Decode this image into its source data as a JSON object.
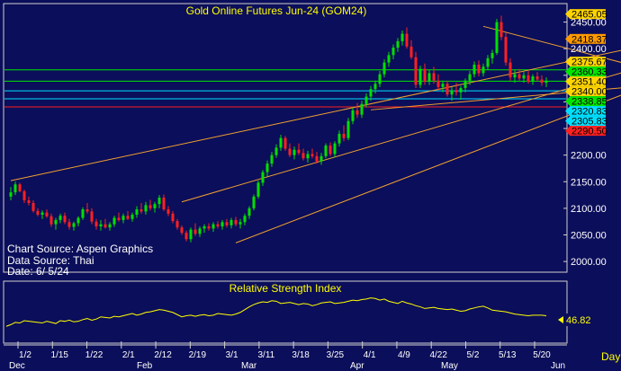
{
  "chart_data": [
    {
      "type": "candlestick",
      "title": "Gold Online Futures Jun-24 (GOM24)",
      "ylim": [
        1985,
        2478
      ],
      "y_ticks": [
        2000.0,
        2050.0,
        2100.0,
        2150.0,
        2200.0,
        2250.0,
        2300.0,
        2350.0,
        2400.0,
        2450.0
      ],
      "price_tags": [
        {
          "value": 2465.05,
          "label": "2465.05",
          "color": "#ffd400"
        },
        {
          "value": 2418.37,
          "label": "2418.37",
          "color": "#ff9a00"
        },
        {
          "value": 2375.67,
          "label": "2375.67",
          "color": "#ffd400"
        },
        {
          "value": 2360.33,
          "label": "2360.33",
          "color": "#00e600"
        },
        {
          "value": 2351.4,
          "label": "2351.40",
          "color": "#ffd400"
        },
        {
          "value": 2340.0,
          "label": "2340.00",
          "color": "#ffd400"
        },
        {
          "value": 2338.85,
          "label": "2338.85",
          "color": "#00e600"
        },
        {
          "value": 2320.83,
          "label": "2320.83",
          "color": "#00e0ff"
        },
        {
          "value": 2305.83,
          "label": "2305.83",
          "color": "#00e0ff"
        },
        {
          "value": 2290.5,
          "label": "2290.50",
          "color": "#ff2020"
        }
      ],
      "hlines": [
        {
          "value": 2360.33,
          "color": "#00e600"
        },
        {
          "value": 2338.85,
          "color": "#00e600"
        },
        {
          "value": 2320.83,
          "color": "#00e0ff"
        },
        {
          "value": 2305.83,
          "color": "#00e0ff"
        },
        {
          "value": 2290.5,
          "color": "#ff2020"
        }
      ],
      "trendlines": [
        {
          "from": [
            0,
            2152
          ],
          "to": [
            154,
            2430
          ]
        },
        {
          "from": [
            38,
            2112
          ],
          "to": [
            154,
            2400
          ]
        },
        {
          "from": [
            50,
            2035
          ],
          "to": [
            154,
            2372
          ]
        },
        {
          "from": [
            105,
            2442
          ],
          "to": [
            152,
            2338
          ]
        },
        {
          "from": [
            80,
            2285
          ],
          "to": [
            154,
            2340
          ]
        }
      ],
      "annotations": [
        "Chart Source: Aspen Graphics",
        "Data Source: Thai",
        "Date: 6/ 5/24"
      ],
      "candles": [
        {
          "o": 2122,
          "h": 2140,
          "l": 2115,
          "c": 2130
        },
        {
          "o": 2130,
          "h": 2150,
          "l": 2125,
          "c": 2145
        },
        {
          "o": 2145,
          "h": 2148,
          "l": 2130,
          "c": 2132
        },
        {
          "o": 2132,
          "h": 2135,
          "l": 2110,
          "c": 2115
        },
        {
          "o": 2115,
          "h": 2122,
          "l": 2105,
          "c": 2110
        },
        {
          "o": 2110,
          "h": 2115,
          "l": 2092,
          "c": 2095
        },
        {
          "o": 2095,
          "h": 2100,
          "l": 2085,
          "c": 2088
        },
        {
          "o": 2088,
          "h": 2096,
          "l": 2080,
          "c": 2092
        },
        {
          "o": 2092,
          "h": 2098,
          "l": 2082,
          "c": 2085
        },
        {
          "o": 2085,
          "h": 2090,
          "l": 2065,
          "c": 2070
        },
        {
          "o": 2070,
          "h": 2082,
          "l": 2060,
          "c": 2078
        },
        {
          "o": 2078,
          "h": 2090,
          "l": 2072,
          "c": 2086
        },
        {
          "o": 2086,
          "h": 2092,
          "l": 2070,
          "c": 2074
        },
        {
          "o": 2074,
          "h": 2080,
          "l": 2060,
          "c": 2065
        },
        {
          "o": 2065,
          "h": 2075,
          "l": 2058,
          "c": 2072
        },
        {
          "o": 2072,
          "h": 2085,
          "l": 2066,
          "c": 2082
        },
        {
          "o": 2082,
          "h": 2102,
          "l": 2078,
          "c": 2098
        },
        {
          "o": 2098,
          "h": 2110,
          "l": 2090,
          "c": 2094
        },
        {
          "o": 2094,
          "h": 2100,
          "l": 2070,
          "c": 2075
        },
        {
          "o": 2075,
          "h": 2080,
          "l": 2060,
          "c": 2066
        },
        {
          "o": 2066,
          "h": 2078,
          "l": 2058,
          "c": 2070
        },
        {
          "o": 2070,
          "h": 2080,
          "l": 2062,
          "c": 2064
        },
        {
          "o": 2064,
          "h": 2074,
          "l": 2058,
          "c": 2070
        },
        {
          "o": 2070,
          "h": 2086,
          "l": 2065,
          "c": 2082
        },
        {
          "o": 2082,
          "h": 2092,
          "l": 2075,
          "c": 2078
        },
        {
          "o": 2078,
          "h": 2090,
          "l": 2072,
          "c": 2086
        },
        {
          "o": 2086,
          "h": 2095,
          "l": 2078,
          "c": 2080
        },
        {
          "o": 2080,
          "h": 2092,
          "l": 2075,
          "c": 2088
        },
        {
          "o": 2088,
          "h": 2104,
          "l": 2082,
          "c": 2098
        },
        {
          "o": 2098,
          "h": 2110,
          "l": 2090,
          "c": 2094
        },
        {
          "o": 2094,
          "h": 2112,
          "l": 2088,
          "c": 2106
        },
        {
          "o": 2106,
          "h": 2116,
          "l": 2096,
          "c": 2100
        },
        {
          "o": 2100,
          "h": 2112,
          "l": 2092,
          "c": 2108
        },
        {
          "o": 2108,
          "h": 2125,
          "l": 2100,
          "c": 2120
        },
        {
          "o": 2120,
          "h": 2126,
          "l": 2095,
          "c": 2098
        },
        {
          "o": 2098,
          "h": 2104,
          "l": 2085,
          "c": 2090
        },
        {
          "o": 2090,
          "h": 2095,
          "l": 2072,
          "c": 2076
        },
        {
          "o": 2076,
          "h": 2080,
          "l": 2060,
          "c": 2064
        },
        {
          "o": 2064,
          "h": 2068,
          "l": 2050,
          "c": 2054
        },
        {
          "o": 2054,
          "h": 2058,
          "l": 2038,
          "c": 2042
        },
        {
          "o": 2042,
          "h": 2064,
          "l": 2036,
          "c": 2060
        },
        {
          "o": 2060,
          "h": 2072,
          "l": 2048,
          "c": 2052
        },
        {
          "o": 2052,
          "h": 2066,
          "l": 2046,
          "c": 2062
        },
        {
          "o": 2062,
          "h": 2070,
          "l": 2054,
          "c": 2066
        },
        {
          "o": 2066,
          "h": 2072,
          "l": 2058,
          "c": 2062
        },
        {
          "o": 2062,
          "h": 2074,
          "l": 2056,
          "c": 2070
        },
        {
          "o": 2070,
          "h": 2076,
          "l": 2062,
          "c": 2066
        },
        {
          "o": 2066,
          "h": 2078,
          "l": 2060,
          "c": 2074
        },
        {
          "o": 2074,
          "h": 2080,
          "l": 2064,
          "c": 2068
        },
        {
          "o": 2068,
          "h": 2082,
          "l": 2062,
          "c": 2078
        },
        {
          "o": 2078,
          "h": 2084,
          "l": 2066,
          "c": 2070
        },
        {
          "o": 2070,
          "h": 2080,
          "l": 2062,
          "c": 2074
        },
        {
          "o": 2074,
          "h": 2090,
          "l": 2068,
          "c": 2086
        },
        {
          "o": 2086,
          "h": 2104,
          "l": 2080,
          "c": 2100
        },
        {
          "o": 2100,
          "h": 2126,
          "l": 2096,
          "c": 2122
        },
        {
          "o": 2122,
          "h": 2152,
          "l": 2118,
          "c": 2148
        },
        {
          "o": 2148,
          "h": 2172,
          "l": 2142,
          "c": 2168
        },
        {
          "o": 2168,
          "h": 2190,
          "l": 2160,
          "c": 2184
        },
        {
          "o": 2184,
          "h": 2206,
          "l": 2178,
          "c": 2200
        },
        {
          "o": 2200,
          "h": 2220,
          "l": 2195,
          "c": 2214
        },
        {
          "o": 2214,
          "h": 2238,
          "l": 2208,
          "c": 2232
        },
        {
          "o": 2232,
          "h": 2236,
          "l": 2208,
          "c": 2212
        },
        {
          "o": 2212,
          "h": 2222,
          "l": 2196,
          "c": 2200
        },
        {
          "o": 2200,
          "h": 2216,
          "l": 2192,
          "c": 2210
        },
        {
          "o": 2210,
          "h": 2222,
          "l": 2200,
          "c": 2204
        },
        {
          "o": 2204,
          "h": 2212,
          "l": 2190,
          "c": 2194
        },
        {
          "o": 2194,
          "h": 2208,
          "l": 2186,
          "c": 2202
        },
        {
          "o": 2202,
          "h": 2212,
          "l": 2194,
          "c": 2198
        },
        {
          "o": 2198,
          "h": 2206,
          "l": 2184,
          "c": 2188
        },
        {
          "o": 2188,
          "h": 2204,
          "l": 2182,
          "c": 2198
        },
        {
          "o": 2198,
          "h": 2222,
          "l": 2194,
          "c": 2218
        },
        {
          "o": 2218,
          "h": 2224,
          "l": 2198,
          "c": 2202
        },
        {
          "o": 2202,
          "h": 2226,
          "l": 2196,
          "c": 2222
        },
        {
          "o": 2222,
          "h": 2246,
          "l": 2216,
          "c": 2240
        },
        {
          "o": 2240,
          "h": 2256,
          "l": 2226,
          "c": 2232
        },
        {
          "o": 2232,
          "h": 2270,
          "l": 2228,
          "c": 2264
        },
        {
          "o": 2264,
          "h": 2290,
          "l": 2258,
          "c": 2284
        },
        {
          "o": 2284,
          "h": 2298,
          "l": 2270,
          "c": 2276
        },
        {
          "o": 2276,
          "h": 2302,
          "l": 2270,
          "c": 2296
        },
        {
          "o": 2296,
          "h": 2316,
          "l": 2290,
          "c": 2310
        },
        {
          "o": 2310,
          "h": 2330,
          "l": 2302,
          "c": 2324
        },
        {
          "o": 2324,
          "h": 2340,
          "l": 2316,
          "c": 2334
        },
        {
          "o": 2334,
          "h": 2358,
          "l": 2328,
          "c": 2352
        },
        {
          "o": 2352,
          "h": 2380,
          "l": 2346,
          "c": 2374
        },
        {
          "o": 2374,
          "h": 2394,
          "l": 2366,
          "c": 2388
        },
        {
          "o": 2388,
          "h": 2408,
          "l": 2380,
          "c": 2402
        },
        {
          "o": 2402,
          "h": 2420,
          "l": 2394,
          "c": 2414
        },
        {
          "o": 2414,
          "h": 2434,
          "l": 2406,
          "c": 2428
        },
        {
          "o": 2428,
          "h": 2440,
          "l": 2400,
          "c": 2404
        },
        {
          "o": 2404,
          "h": 2416,
          "l": 2380,
          "c": 2384
        },
        {
          "o": 2384,
          "h": 2394,
          "l": 2326,
          "c": 2332
        },
        {
          "o": 2332,
          "h": 2368,
          "l": 2326,
          "c": 2362
        },
        {
          "o": 2362,
          "h": 2372,
          "l": 2332,
          "c": 2338
        },
        {
          "o": 2338,
          "h": 2360,
          "l": 2332,
          "c": 2354
        },
        {
          "o": 2354,
          "h": 2366,
          "l": 2334,
          "c": 2340
        },
        {
          "o": 2340,
          "h": 2352,
          "l": 2322,
          "c": 2328
        },
        {
          "o": 2328,
          "h": 2340,
          "l": 2318,
          "c": 2334
        },
        {
          "o": 2334,
          "h": 2340,
          "l": 2310,
          "c": 2314
        },
        {
          "o": 2314,
          "h": 2328,
          "l": 2302,
          "c": 2322
        },
        {
          "o": 2322,
          "h": 2336,
          "l": 2312,
          "c": 2318
        },
        {
          "o": 2318,
          "h": 2330,
          "l": 2304,
          "c": 2326
        },
        {
          "o": 2326,
          "h": 2344,
          "l": 2318,
          "c": 2340
        },
        {
          "o": 2340,
          "h": 2358,
          "l": 2332,
          "c": 2352
        },
        {
          "o": 2352,
          "h": 2376,
          "l": 2346,
          "c": 2370
        },
        {
          "o": 2370,
          "h": 2378,
          "l": 2348,
          "c": 2354
        },
        {
          "o": 2354,
          "h": 2372,
          "l": 2348,
          "c": 2366
        },
        {
          "o": 2366,
          "h": 2388,
          "l": 2360,
          "c": 2382
        },
        {
          "o": 2382,
          "h": 2398,
          "l": 2372,
          "c": 2392
        },
        {
          "o": 2392,
          "h": 2456,
          "l": 2388,
          "c": 2450
        },
        {
          "o": 2450,
          "h": 2462,
          "l": 2416,
          "c": 2422
        },
        {
          "o": 2422,
          "h": 2430,
          "l": 2368,
          "c": 2374
        },
        {
          "o": 2374,
          "h": 2382,
          "l": 2340,
          "c": 2346
        },
        {
          "o": 2346,
          "h": 2360,
          "l": 2336,
          "c": 2352
        },
        {
          "o": 2352,
          "h": 2362,
          "l": 2340,
          "c": 2344
        },
        {
          "o": 2344,
          "h": 2356,
          "l": 2336,
          "c": 2350
        },
        {
          "o": 2350,
          "h": 2358,
          "l": 2334,
          "c": 2338
        },
        {
          "o": 2338,
          "h": 2352,
          "l": 2332,
          "c": 2348
        },
        {
          "o": 2348,
          "h": 2356,
          "l": 2338,
          "c": 2342
        },
        {
          "o": 2342,
          "h": 2350,
          "l": 2330,
          "c": 2336
        },
        {
          "o": 2336,
          "h": 2346,
          "l": 2328,
          "c": 2340
        }
      ],
      "candle_colors": {
        "up": "#00e000",
        "down": "#ff2020"
      }
    },
    {
      "type": "line",
      "title": "Relative Strength Index",
      "ylim": [
        0,
        100
      ],
      "last_value_label": "46.82",
      "series": [
        {
          "color": "#ffff00",
          "values": [
            27,
            30,
            34,
            33,
            37,
            36,
            35,
            34,
            33,
            36,
            34,
            32,
            37,
            36,
            38,
            35,
            36,
            39,
            41,
            38,
            40,
            44,
            43,
            42,
            45,
            44,
            46,
            48,
            50,
            47,
            49,
            52,
            53,
            55,
            57,
            56,
            54,
            52,
            48,
            44,
            46,
            47,
            45,
            47,
            48,
            46,
            47,
            50,
            49,
            48,
            47,
            49,
            52,
            57,
            62,
            66,
            69,
            71,
            70,
            73,
            72,
            68,
            69,
            70,
            68,
            66,
            68,
            67,
            64,
            66,
            69,
            70,
            71,
            68,
            69,
            70,
            72,
            74,
            73,
            75,
            76,
            78,
            77,
            74,
            76,
            72,
            70,
            68,
            72,
            69,
            67,
            64,
            62,
            59,
            60,
            61,
            59,
            58,
            57,
            58,
            56,
            54,
            55,
            58,
            60,
            62,
            63,
            60,
            56,
            55,
            54,
            53,
            51,
            49,
            48,
            47,
            46,
            47,
            47,
            47,
            46
          ]
        }
      ]
    }
  ],
  "x_axis": {
    "ticks": [
      "1/2",
      "1/15",
      "1/22",
      "2/1",
      "2/12",
      "2/19",
      "3/1",
      "3/11",
      "3/18",
      "3/25",
      "4/1",
      "4/9",
      "4/22",
      "5/2",
      "5/13",
      "5/20"
    ],
    "months": [
      "Dec",
      "Feb",
      "Mar",
      "Apr",
      "May",
      "Jun"
    ],
    "period": "Day"
  }
}
